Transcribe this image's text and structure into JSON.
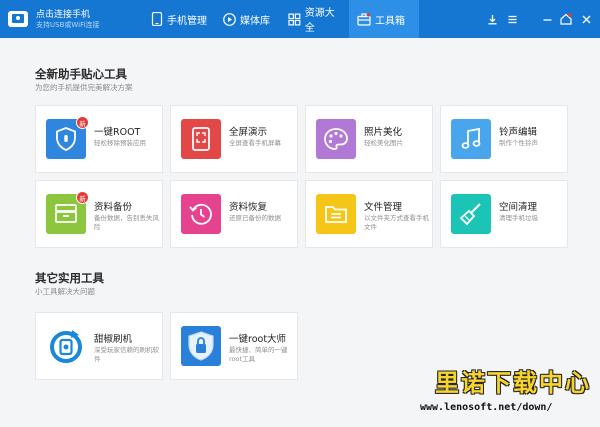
{
  "app": {
    "title": "点击连接手机",
    "subtitle": "支持USB或WiFi连接"
  },
  "nav": {
    "phone": "手机管理",
    "media": "媒体库",
    "resources": "资源大全",
    "tools": "工具箱"
  },
  "section1": {
    "title": "全新助手贴心工具",
    "subtitle": "为您的手机提供完美解决方案"
  },
  "section2": {
    "title": "其它实用工具",
    "subtitle": "小工具解决大问题"
  },
  "badge_label": "新",
  "tools": [
    {
      "name": "一键ROOT",
      "desc": "轻松移除预装应用",
      "color": "#2f86df",
      "icon": "shield-icon",
      "badge": true
    },
    {
      "name": "全屏演示",
      "desc": "全屏查看手机屏幕",
      "color": "#e24848",
      "icon": "fullscreen-icon",
      "badge": false
    },
    {
      "name": "照片美化",
      "desc": "轻松美化图片",
      "color": "#b278d6",
      "icon": "palette-icon",
      "badge": false
    },
    {
      "name": "铃声编辑",
      "desc": "制作个性铃声",
      "color": "#49a6ec",
      "icon": "music-note-icon",
      "badge": false
    },
    {
      "name": "资料备份",
      "desc": "备份数据，告别丢失风险",
      "color": "#8cc63f",
      "icon": "backup-box-icon",
      "badge": true
    },
    {
      "name": "资料恢复",
      "desc": "还原已备份的数据",
      "color": "#e6438f",
      "icon": "clock-restore-icon",
      "badge": false
    },
    {
      "name": "文件管理",
      "desc": "以文件夹方式查看手机文件",
      "color": "#f5c518",
      "icon": "folder-icon",
      "badge": false
    },
    {
      "name": "空间清理",
      "desc": "清理手机垃圾",
      "color": "#1cc4b6",
      "icon": "broom-icon",
      "badge": false
    }
  ],
  "others": [
    {
      "name": "甜椒刷机",
      "desc": "深受玩家信赖的刷机软件",
      "icon": "flash-icon"
    },
    {
      "name": "一键root大师",
      "desc": "最快捷、简单的一键root工具",
      "icon": "root-master-icon"
    }
  ],
  "watermark": {
    "cn": "里诺下载中心",
    "url": "www.lenosoft.net/down/"
  }
}
